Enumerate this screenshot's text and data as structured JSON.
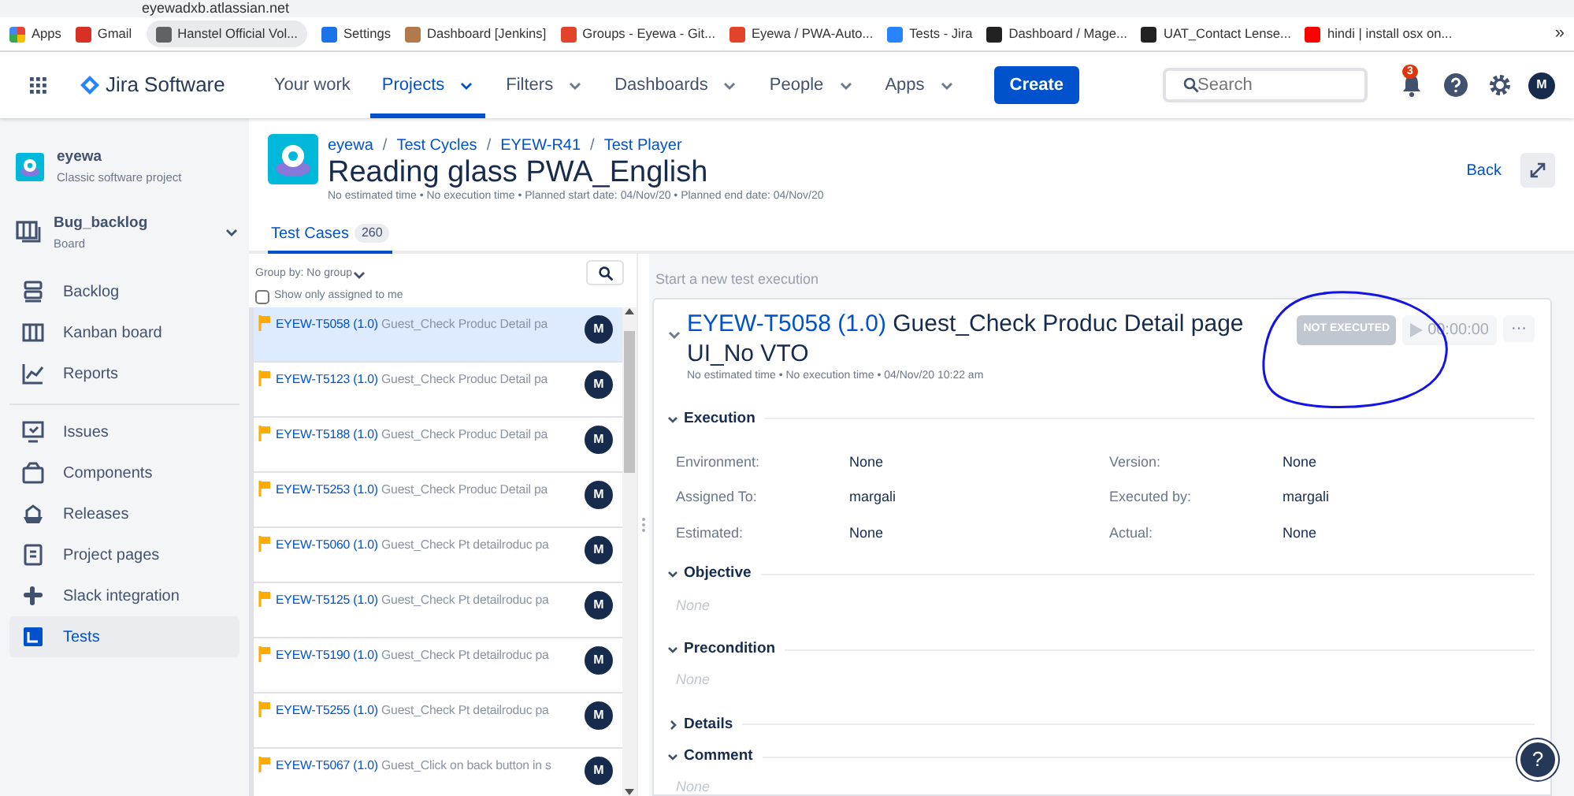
{
  "browser": {
    "url": "eyewadxb.atlassian.net",
    "bookmarks": [
      {
        "label": "Apps"
      },
      {
        "label": "Gmail"
      },
      {
        "label": "Hanstel Official Vol..."
      },
      {
        "label": "Settings"
      },
      {
        "label": "Dashboard [Jenkins]"
      },
      {
        "label": "Groups - Eyewa - Git..."
      },
      {
        "label": "Eyewa / PWA-Auto..."
      },
      {
        "label": "Tests - Jira"
      },
      {
        "label": "Dashboard / Mage..."
      },
      {
        "label": "UAT_Contact Lense..."
      },
      {
        "label": "hindi | install osx on..."
      }
    ],
    "more": "»"
  },
  "nav": {
    "product": "Jira Software",
    "items": [
      {
        "label": "Your work",
        "selected": false,
        "dropdown": false
      },
      {
        "label": "Projects",
        "selected": true,
        "dropdown": true
      },
      {
        "label": "Filters",
        "selected": false,
        "dropdown": true
      },
      {
        "label": "Dashboards",
        "selected": false,
        "dropdown": true
      },
      {
        "label": "People",
        "selected": false,
        "dropdown": true
      },
      {
        "label": "Apps",
        "selected": false,
        "dropdown": true
      }
    ],
    "create": "Create",
    "search": {
      "placeholder": "Search"
    },
    "notifications": "3",
    "avatar": "M"
  },
  "sidebar": {
    "project": {
      "name": "eyewa",
      "type": "Classic software project"
    },
    "board": {
      "name": "Bug_backlog",
      "type": "Board"
    },
    "sections": [
      {
        "items": [
          {
            "label": "Backlog",
            "selected": false
          },
          {
            "label": "Kanban board",
            "selected": false
          },
          {
            "label": "Reports",
            "selected": false
          }
        ]
      },
      {
        "items": [
          {
            "label": "Issues",
            "selected": false
          },
          {
            "label": "Components",
            "selected": false
          },
          {
            "label": "Releases",
            "selected": false
          },
          {
            "label": "Project pages",
            "selected": false
          },
          {
            "label": "Slack integration",
            "selected": false
          },
          {
            "label": "Tests",
            "selected": true
          }
        ]
      }
    ]
  },
  "header": {
    "breadcrumbs": [
      "eyewa",
      "Test Cycles",
      "EYEW-R41",
      "Test Player"
    ],
    "separator": "/",
    "title": "Reading glass PWA_English",
    "meta": "No estimated time • No execution time • Planned start date: 04/Nov/20 • Planned end date: 04/Nov/20",
    "back": "Back"
  },
  "tabs": [
    {
      "label": "Test Cases",
      "count": "260",
      "selected": true
    }
  ],
  "cases": {
    "group_by": "Group by: No group",
    "assigned_only": {
      "label": "Show only assigned to me",
      "checked": false
    },
    "rows": [
      {
        "key": "EYEW-T5058",
        "version": "(1.0)",
        "title": "Guest_Check Produc Detail pa",
        "avatar": "M",
        "selected": true
      },
      {
        "key": "EYEW-T5123",
        "version": "(1.0)",
        "title": "Guest_Check Produc Detail pa",
        "avatar": "M",
        "selected": false
      },
      {
        "key": "EYEW-T5188",
        "version": "(1.0)",
        "title": "Guest_Check Produc Detail pa",
        "avatar": "M",
        "selected": false
      },
      {
        "key": "EYEW-T5253",
        "version": "(1.0)",
        "title": "Guest_Check Produc Detail pa",
        "avatar": "M",
        "selected": false
      },
      {
        "key": "EYEW-T5060",
        "version": "(1.0)",
        "title": "Guest_Check Pt detailroduc pa",
        "avatar": "M",
        "selected": false
      },
      {
        "key": "EYEW-T5125",
        "version": "(1.0)",
        "title": "Guest_Check Pt detailroduc pa",
        "avatar": "M",
        "selected": false
      },
      {
        "key": "EYEW-T5190",
        "version": "(1.0)",
        "title": "Guest_Check Pt detailroduc pa",
        "avatar": "M",
        "selected": false
      },
      {
        "key": "EYEW-T5255",
        "version": "(1.0)",
        "title": "Guest_Check Pt detailroduc pa",
        "avatar": "M",
        "selected": false
      },
      {
        "key": "EYEW-T5067",
        "version": "(1.0)",
        "title": "Guest_Click on back button in s",
        "avatar": "M",
        "selected": false
      }
    ]
  },
  "execution": {
    "placeholder": "Start a new test execution",
    "key": "EYEW-T5058",
    "version": "(1.0)",
    "title": "Guest_Check Produc Detail page UI_No VTO",
    "meta": "No estimated time • No execution time • 04/Nov/20 10:22 am",
    "status": "NOT EXECUTED",
    "timer": "00:00:00",
    "more": "···",
    "sections": [
      {
        "title": "Execution",
        "expanded": true,
        "fields": [
          {
            "label": "Environment:",
            "value": "None"
          },
          {
            "label": "Version:",
            "value": "None"
          },
          {
            "label": "Assigned To:",
            "value": "margali"
          },
          {
            "label": "Executed by:",
            "value": "margali"
          },
          {
            "label": "Estimated:",
            "value": "None"
          },
          {
            "label": "Actual:",
            "value": "None"
          }
        ]
      },
      {
        "title": "Objective",
        "expanded": true,
        "value": "None"
      },
      {
        "title": "Precondition",
        "expanded": true,
        "value": "None"
      },
      {
        "title": "Details",
        "expanded": false
      },
      {
        "title": "Comment",
        "expanded": true,
        "value": "None"
      }
    ]
  },
  "help": "?",
  "annotation": {
    "kind": "ellipse"
  }
}
